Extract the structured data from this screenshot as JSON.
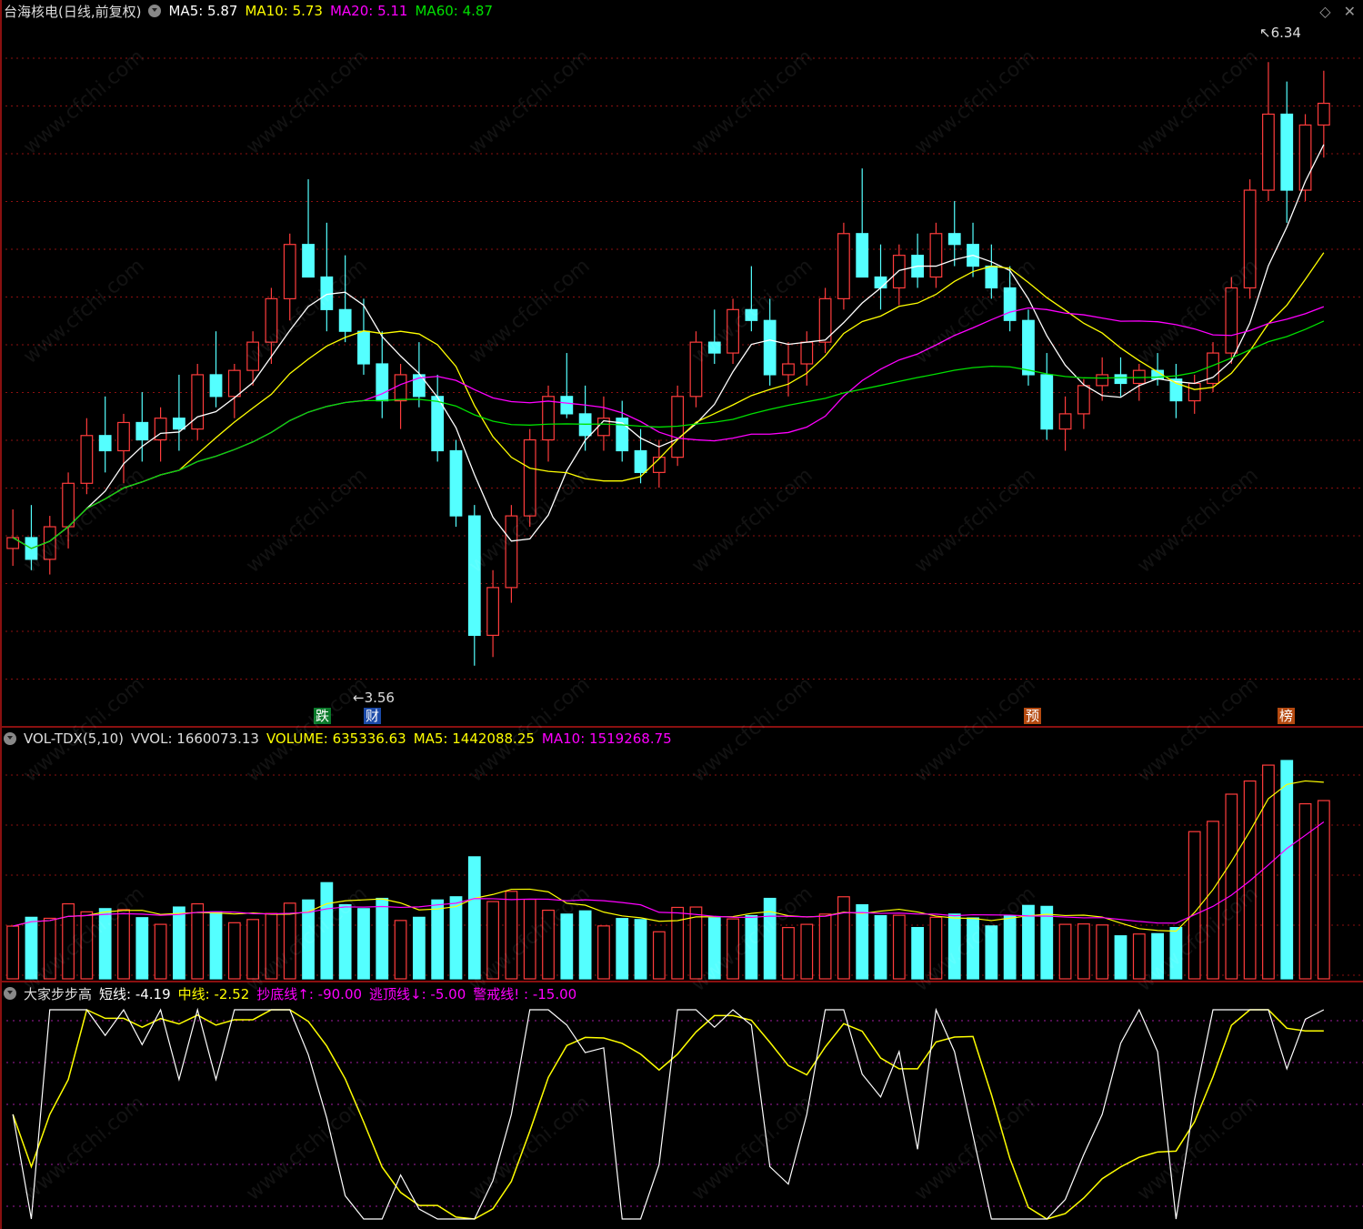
{
  "main_header": {
    "stock": "台海核电(日线,前复权)",
    "ma5": "MA5: 5.87",
    "ma10": "MA10: 5.73",
    "ma20": "MA20: 5.11",
    "ma60": "MA60: 4.87"
  },
  "vol_header": {
    "name": "VOL-TDX(5,10)",
    "vvol": "VVOL: 1660073.13",
    "volume": "VOLUME: 635336.63",
    "ma5": "MA5: 1442088.25",
    "ma10": "MA10: 1519268.75"
  },
  "ind_header": {
    "name": "大家步步高",
    "short": "短线: -4.19",
    "mid": "中线: -2.52",
    "bottom": "抄底线↑: -90.00",
    "top": "逃顶线↓: -5.00",
    "warn": "警戒线!  : -15.00"
  },
  "annotations": {
    "high": "6.34",
    "low": "3.56",
    "tag_die": "跌",
    "tag_cai": "财",
    "tag_yu": "预",
    "tag_bang": "榜"
  },
  "watermark": "www.cfchi.com",
  "top_icons": [
    "diamond-icon",
    "close-icon"
  ],
  "colors": {
    "up": "#ff3c3c",
    "down": "#54ffff",
    "ma5": "#ffffff",
    "ma10": "#ffff00",
    "ma20": "#ff00ff",
    "ma60": "#00e000",
    "grid": "#8a1010"
  },
  "chart_data": {
    "type": "candlestick",
    "y_range": [
      3.4,
      6.5
    ],
    "candles": [
      [
        4.1,
        4.28,
        4.02,
        4.15
      ],
      [
        4.15,
        4.3,
        4.0,
        4.05
      ],
      [
        4.05,
        4.25,
        3.98,
        4.2
      ],
      [
        4.2,
        4.45,
        4.1,
        4.4
      ],
      [
        4.4,
        4.7,
        4.35,
        4.62
      ],
      [
        4.62,
        4.8,
        4.45,
        4.55
      ],
      [
        4.55,
        4.72,
        4.4,
        4.68
      ],
      [
        4.68,
        4.82,
        4.5,
        4.6
      ],
      [
        4.6,
        4.75,
        4.5,
        4.7
      ],
      [
        4.7,
        4.9,
        4.55,
        4.65
      ],
      [
        4.65,
        4.95,
        4.6,
        4.9
      ],
      [
        4.9,
        5.1,
        4.75,
        4.8
      ],
      [
        4.8,
        4.95,
        4.7,
        4.92
      ],
      [
        4.92,
        5.1,
        4.85,
        5.05
      ],
      [
        5.05,
        5.3,
        4.95,
        5.25
      ],
      [
        5.25,
        5.55,
        5.15,
        5.5
      ],
      [
        5.5,
        5.8,
        5.4,
        5.35
      ],
      [
        5.35,
        5.6,
        5.1,
        5.2
      ],
      [
        5.2,
        5.45,
        5.05,
        5.1
      ],
      [
        5.1,
        5.25,
        4.9,
        4.95
      ],
      [
        4.95,
        5.1,
        4.7,
        4.78
      ],
      [
        4.78,
        4.95,
        4.65,
        4.9
      ],
      [
        4.9,
        5.05,
        4.75,
        4.8
      ],
      [
        4.8,
        4.9,
        4.5,
        4.55
      ],
      [
        4.55,
        4.6,
        4.2,
        4.25
      ],
      [
        4.25,
        4.3,
        3.56,
        3.7
      ],
      [
        3.7,
        4.0,
        3.6,
        3.92
      ],
      [
        3.92,
        4.3,
        3.85,
        4.25
      ],
      [
        4.25,
        4.65,
        4.2,
        4.6
      ],
      [
        4.6,
        4.85,
        4.5,
        4.8
      ],
      [
        4.8,
        5.0,
        4.7,
        4.72
      ],
      [
        4.72,
        4.85,
        4.55,
        4.62
      ],
      [
        4.62,
        4.8,
        4.55,
        4.7
      ],
      [
        4.7,
        4.78,
        4.5,
        4.55
      ],
      [
        4.55,
        4.65,
        4.4,
        4.45
      ],
      [
        4.45,
        4.6,
        4.38,
        4.52
      ],
      [
        4.52,
        4.85,
        4.48,
        4.8
      ],
      [
        4.8,
        5.1,
        4.75,
        5.05
      ],
      [
        5.05,
        5.2,
        4.95,
        5.0
      ],
      [
        5.0,
        5.25,
        4.95,
        5.2
      ],
      [
        5.2,
        5.4,
        5.1,
        5.15
      ],
      [
        5.15,
        5.25,
        4.85,
        4.9
      ],
      [
        4.9,
        5.05,
        4.8,
        4.95
      ],
      [
        4.95,
        5.1,
        4.85,
        5.05
      ],
      [
        5.05,
        5.3,
        5.0,
        5.25
      ],
      [
        5.25,
        5.6,
        5.2,
        5.55
      ],
      [
        5.55,
        5.85,
        5.45,
        5.35
      ],
      [
        5.35,
        5.5,
        5.2,
        5.3
      ],
      [
        5.3,
        5.5,
        5.22,
        5.45
      ],
      [
        5.45,
        5.55,
        5.3,
        5.35
      ],
      [
        5.35,
        5.6,
        5.3,
        5.55
      ],
      [
        5.55,
        5.7,
        5.4,
        5.5
      ],
      [
        5.5,
        5.6,
        5.35,
        5.4
      ],
      [
        5.4,
        5.5,
        5.25,
        5.3
      ],
      [
        5.3,
        5.4,
        5.1,
        5.15
      ],
      [
        5.15,
        5.2,
        4.85,
        4.9
      ],
      [
        4.9,
        5.0,
        4.6,
        4.65
      ],
      [
        4.65,
        4.8,
        4.55,
        4.72
      ],
      [
        4.72,
        4.88,
        4.65,
        4.85
      ],
      [
        4.85,
        4.98,
        4.78,
        4.9
      ],
      [
        4.9,
        4.98,
        4.8,
        4.86
      ],
      [
        4.86,
        4.95,
        4.78,
        4.92
      ],
      [
        4.92,
        5.0,
        4.85,
        4.88
      ],
      [
        4.88,
        4.95,
        4.7,
        4.78
      ],
      [
        4.78,
        4.9,
        4.72,
        4.86
      ],
      [
        4.86,
        5.05,
        4.82,
        5.0
      ],
      [
        5.0,
        5.35,
        4.95,
        5.3
      ],
      [
        5.3,
        5.8,
        5.25,
        5.75
      ],
      [
        5.75,
        6.34,
        5.7,
        6.1
      ],
      [
        6.1,
        6.25,
        5.6,
        5.75
      ],
      [
        5.75,
        6.1,
        5.7,
        6.05
      ],
      [
        6.05,
        6.3,
        5.9,
        6.15
      ]
    ]
  }
}
